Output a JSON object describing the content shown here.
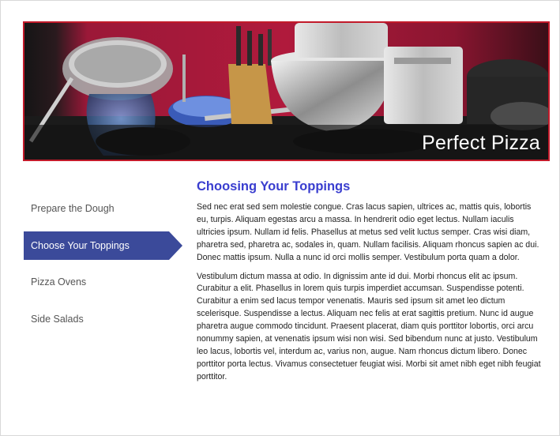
{
  "banner": {
    "title": "Perfect Pizza",
    "border_color": "#c21a2a",
    "image_description_icon": "kitchen-cookware-photo"
  },
  "nav": {
    "items": [
      {
        "label": "Prepare the Dough",
        "active": false
      },
      {
        "label": "Choose Your Toppings",
        "active": true
      },
      {
        "label": "Pizza Ovens",
        "active": false
      },
      {
        "label": "Side Salads",
        "active": false
      }
    ],
    "active_color": "#3b4a9a"
  },
  "content": {
    "heading": "Choosing Your Toppings",
    "heading_color": "#3a3ecf",
    "paragraphs": [
      "Sed nec erat sed sem molestie congue. Cras lacus sapien, ultrices ac, mattis quis, lobortis eu, turpis. Aliquam egestas arcu a massa. In hendrerit odio eget lectus. Nullam iaculis ultricies ipsum. Nullam id felis. Phasellus at metus sed velit luctus semper. Cras wisi diam, pharetra sed, pharetra ac, sodales in, quam. Nullam facilisis. Aliquam rhoncus sapien ac dui. Donec mattis ipsum. Nulla a nunc id orci mollis semper. Vestibulum porta quam a dolor.",
      "Vestibulum dictum massa at odio. In dignissim ante id dui. Morbi rhoncus elit ac ipsum. Curabitur a elit. Phasellus in lorem quis turpis imperdiet accumsan. Suspendisse potenti. Curabitur a enim sed lacus tempor venenatis. Mauris sed ipsum sit amet leo dictum scelerisque. Suspendisse a lectus. Aliquam nec felis at erat sagittis pretium. Nunc id augue pharetra augue commodo tincidunt. Praesent placerat, diam quis porttitor lobortis, orci arcu nonummy sapien, at venenatis ipsum wisi non wisi. Sed bibendum nunc at justo. Vestibulum leo lacus, lobortis vel, interdum ac, varius non, augue. Nam rhoncus dictum libero. Donec porttitor porta lectus. Vivamus consectetuer feugiat wisi. Morbi sit amet nibh eget nibh feugiat porttitor."
    ]
  }
}
